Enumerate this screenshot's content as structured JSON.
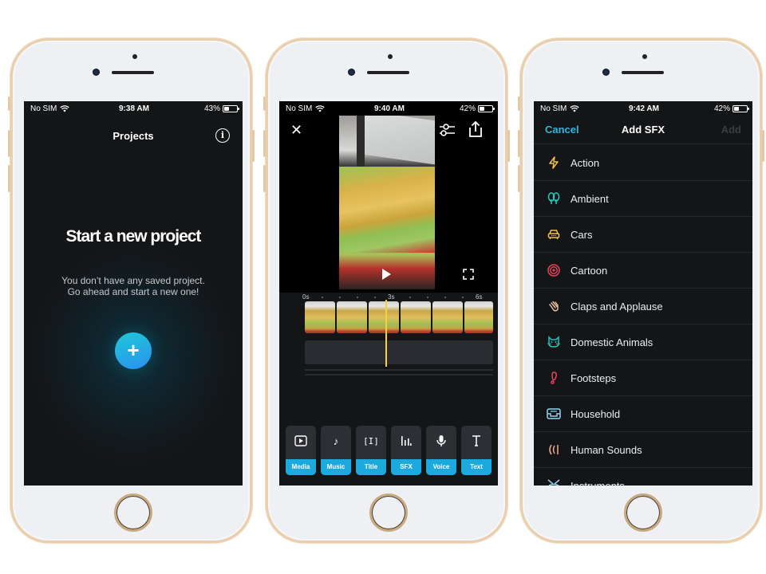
{
  "phones": [
    {
      "status": {
        "carrier": "No SIM",
        "time": "9:38 AM",
        "battery": "43%",
        "battery_level": 0.43
      },
      "projects": {
        "title": "Projects",
        "info_icon": "info-icon",
        "heading": "Start a new project",
        "message_line1": "You don’t have any saved project.",
        "message_line2": "Go ahead and start a new one!",
        "new_button_label": "+"
      }
    },
    {
      "status": {
        "carrier": "No SIM",
        "time": "9:40 AM",
        "battery": "42%",
        "battery_level": 0.42
      },
      "editor": {
        "close_label": "✕",
        "timeline_labels": [
          "0s",
          "3s",
          "6s"
        ],
        "frame_count": 6,
        "tools": [
          {
            "label": "Media",
            "icon": "media-icon"
          },
          {
            "label": "Music",
            "icon": "music-icon"
          },
          {
            "label": "Title",
            "icon": "title-icon"
          },
          {
            "label": "SFX",
            "icon": "sfx-icon"
          },
          {
            "label": "Voice",
            "icon": "microphone-icon"
          },
          {
            "label": "Text",
            "icon": "text-icon"
          }
        ]
      }
    },
    {
      "status": {
        "carrier": "No SIM",
        "time": "9:42 AM",
        "battery": "42%",
        "battery_level": 0.42
      },
      "sfx": {
        "cancel_label": "Cancel",
        "title": "Add SFX",
        "add_label": "Add",
        "items": [
          {
            "label": "Action",
            "icon": "lightning-icon",
            "color": "#f2c14e"
          },
          {
            "label": "Ambient",
            "icon": "trees-icon",
            "color": "#1fc7b6"
          },
          {
            "label": "Cars",
            "icon": "car-icon",
            "color": "#f2c14e"
          },
          {
            "label": "Cartoon",
            "icon": "target-icon",
            "color": "#e8435a"
          },
          {
            "label": "Claps and Applause",
            "icon": "clap-icon",
            "color": "#f3c9a8"
          },
          {
            "label": "Domestic Animals",
            "icon": "cat-icon",
            "color": "#1fc7b6"
          },
          {
            "label": "Footsteps",
            "icon": "footstep-icon",
            "color": "#e8435a"
          },
          {
            "label": "Household",
            "icon": "sofa-icon",
            "color": "#8fd3f2"
          },
          {
            "label": "Human Sounds",
            "icon": "voice-waves-icon",
            "color": "#f3a98c"
          },
          {
            "label": "Instruments",
            "icon": "drum-icon",
            "color": "#8fd3f2"
          }
        ]
      }
    }
  ]
}
